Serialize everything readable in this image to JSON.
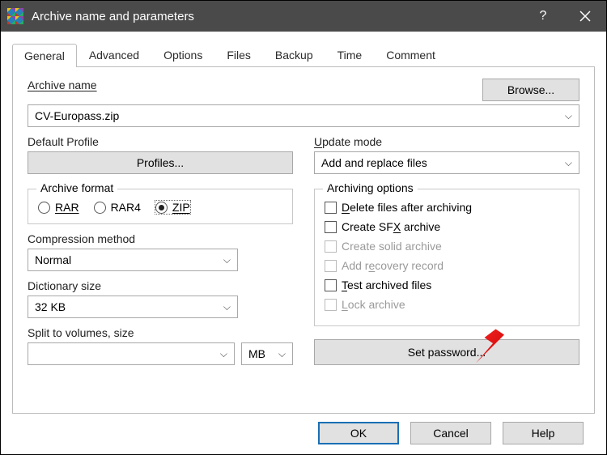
{
  "window": {
    "title": "Archive name and parameters"
  },
  "tabs": [
    "General",
    "Advanced",
    "Options",
    "Files",
    "Backup",
    "Time",
    "Comment"
  ],
  "active_tab": "General",
  "general": {
    "archive_name_label": "Archive name",
    "browse_button": "Browse...",
    "archive_name_value": "CV-Europass.zip",
    "default_profile_label": "Default Profile",
    "profiles_button": "Profiles...",
    "update_mode_label": "Update mode",
    "update_mode_value": "Add and replace files",
    "archive_format_label": "Archive format",
    "formats": [
      "RAR",
      "RAR4",
      "ZIP"
    ],
    "format_selected": "ZIP",
    "compression_label": "Compression method",
    "compression_value": "Normal",
    "dictionary_label": "Dictionary size",
    "dictionary_value": "32 KB",
    "split_label": "Split to volumes, size",
    "split_value": "",
    "split_unit": "MB",
    "archiving_options_label": "Archiving options",
    "options": {
      "delete": {
        "label": "Delete files after archiving",
        "checked": false,
        "enabled": true
      },
      "sfx": {
        "label": "Create SFX archive",
        "checked": false,
        "enabled": true
      },
      "solid": {
        "label": "Create solid archive",
        "checked": false,
        "enabled": false
      },
      "recovery": {
        "label": "Add recovery record",
        "checked": false,
        "enabled": false
      },
      "test": {
        "label": "Test archived files",
        "checked": false,
        "enabled": true
      },
      "lock": {
        "label": "Lock archive",
        "checked": false,
        "enabled": false
      }
    },
    "set_password_button": "Set password..."
  },
  "dialog_buttons": {
    "ok": "OK",
    "cancel": "Cancel",
    "help": "Help"
  }
}
